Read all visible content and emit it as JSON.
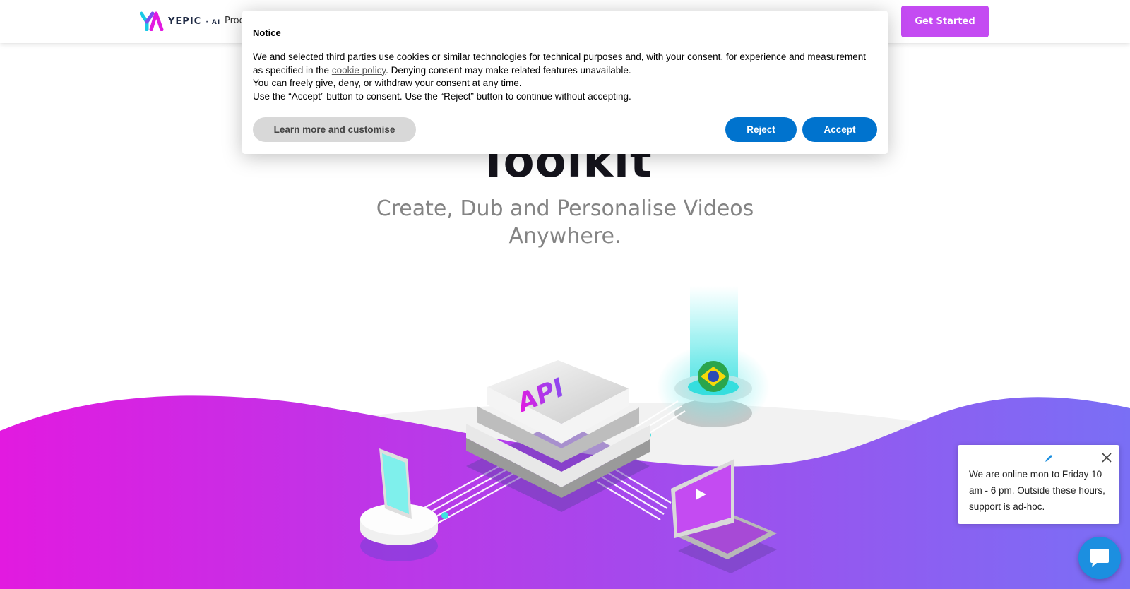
{
  "header": {
    "logo_text": "YEPIC",
    "logo_suffix": "AI",
    "nav_products": "Prod",
    "cta_label": "Get Started"
  },
  "hero": {
    "title": "Toolkit",
    "subtitle": "Create, Dub and Personalise Videos Anywhere.",
    "api_label": "API"
  },
  "cookie": {
    "title": "Notice",
    "para1_before_link": "We and selected third parties use cookies or similar technologies for technical purposes and, with your consent, for experience and measurement as specified in the ",
    "link_text": "cookie policy",
    "para1_after_link": ". Denying consent may make related features unavailable.",
    "para2": "You can freely give, deny, or withdraw your consent at any time.",
    "para3": "Use the “Accept” button to consent. Use the “Reject” button to continue without accepting.",
    "learn_more_label": "Learn more and customise",
    "reject_label": "Reject",
    "accept_label": "Accept"
  },
  "chat": {
    "message": "We are online mon to Friday 10 am - 6 pm. Outside these hours, support is ad-hoc.",
    "icons": {
      "pen": "pen-icon",
      "close": "close-icon",
      "launcher": "chat-bubble-icon"
    }
  },
  "colors": {
    "brand_purple": "#c44bf2",
    "wave_magenta": "#e21ae0",
    "wave_violet": "#7a6ff5",
    "cookie_button_blue": "#0073ce",
    "chat_blue": "#1c8fe0"
  }
}
